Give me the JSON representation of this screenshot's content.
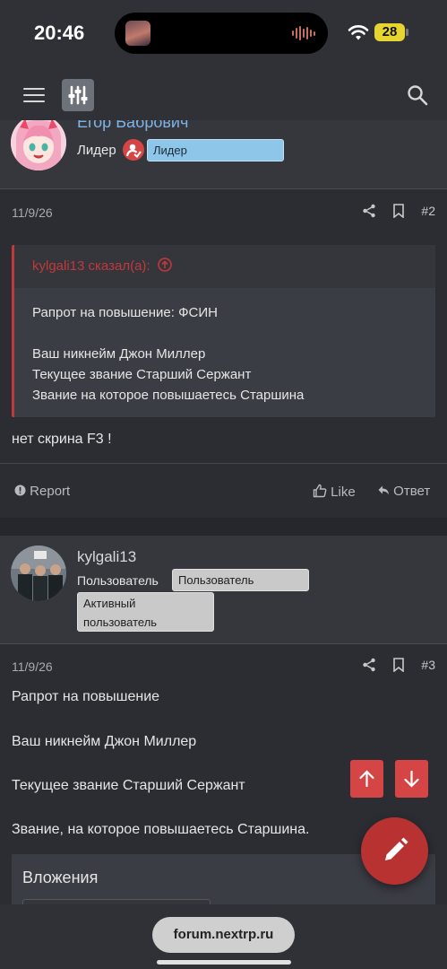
{
  "status_bar": {
    "time": "20:46",
    "battery": "28"
  },
  "header": {
    "menu_icon": "hamburger-icon",
    "filter_icon": "sliders-icon",
    "search_icon": "search-icon"
  },
  "posts": [
    {
      "username": "Егор Бабрович",
      "role": "Лидер",
      "badges": [
        "Лидер"
      ],
      "date": "11/9/26",
      "number": "#2",
      "quote_author": "kylgali13 сказал(а):",
      "quote_lines": [
        "Рапрот на повышение: ФСИН",
        "",
        "Ваш никнейм Джон Миллер",
        "Текущее звание Старший Сержант",
        "Звание на которое повышаетесь Старшина"
      ],
      "text": "нет скрина F3 !",
      "actions": {
        "report": "Report",
        "like": "Like",
        "reply": "Ответ"
      }
    },
    {
      "username": "kylgali13",
      "role": "Пользователь",
      "badges": [
        "Пользователь",
        "Активный пользователь"
      ],
      "date": "11/9/26",
      "number": "#3",
      "lines": [
        "Рапрот на повышение",
        "Ваш никнейм Джон Миллер",
        "Текущее звание Старший Сержант",
        "Звание, на которое повышаетесь Старшина."
      ],
      "attachments_title": "Вложения"
    }
  ],
  "bottom_bar": {
    "url": "forum.nextrp.ru"
  },
  "colors": {
    "accent_red": "#d64545",
    "link_blue": "#7fb3e6",
    "badge_blue": "#8ec6ea"
  }
}
